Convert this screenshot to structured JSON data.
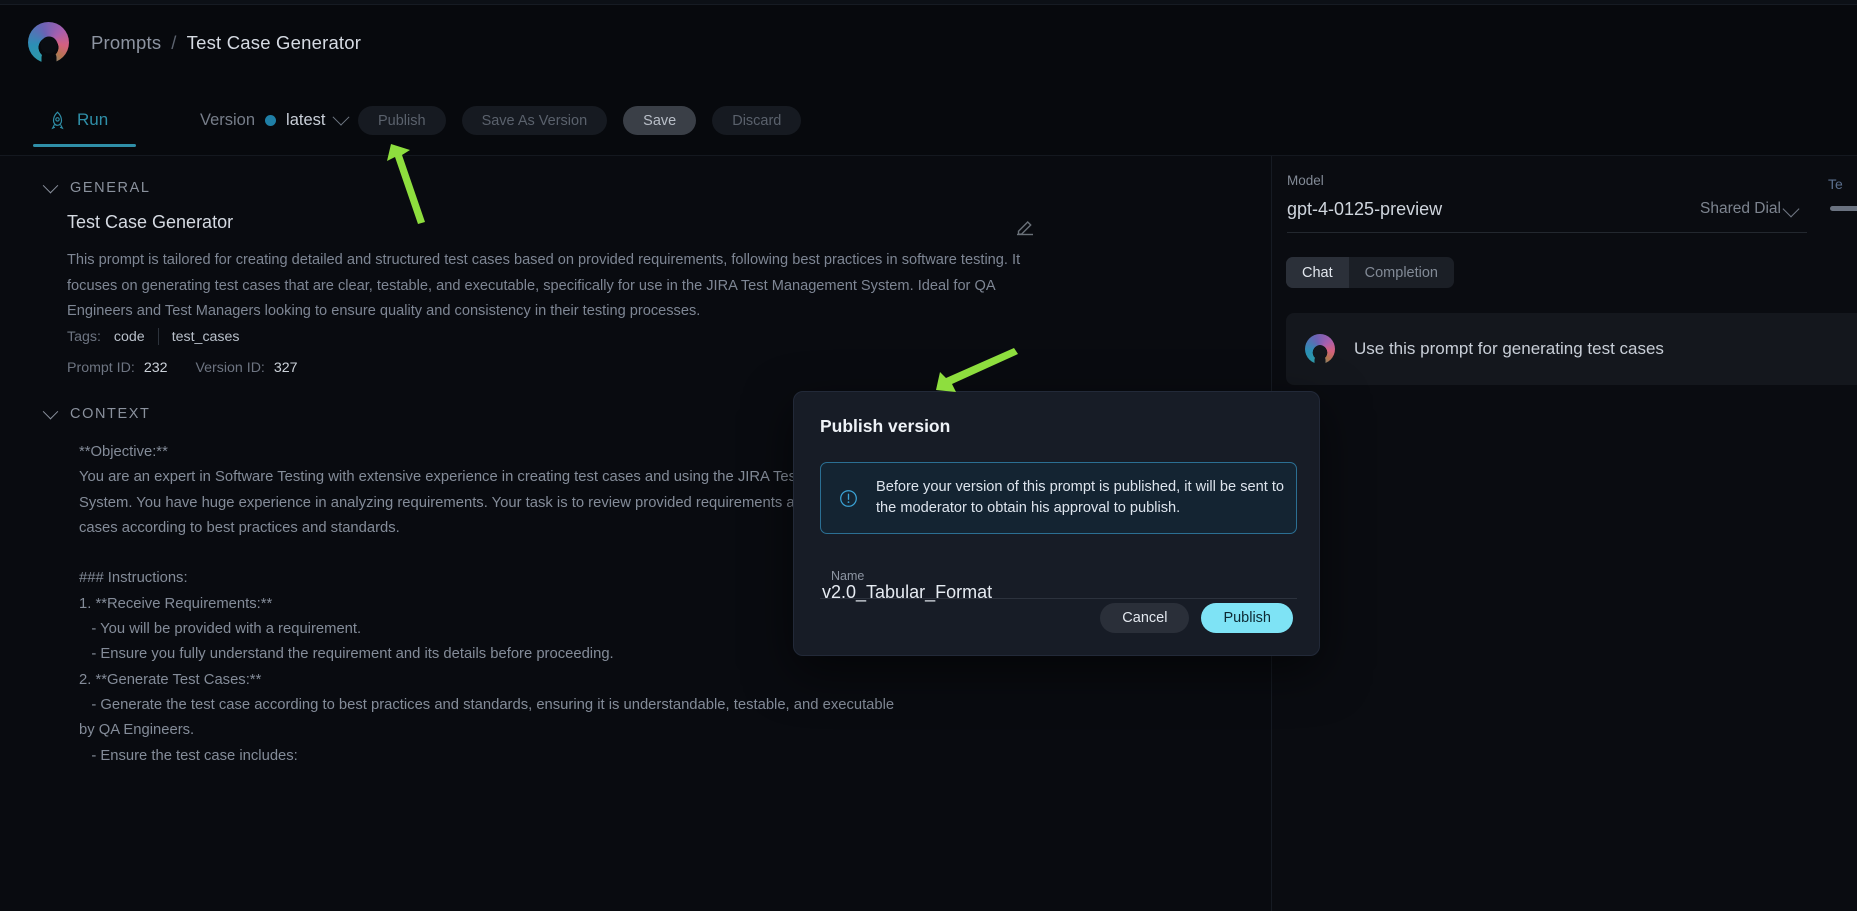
{
  "header": {
    "breadcrumb_root": "Prompts",
    "breadcrumb_separator": "/",
    "breadcrumb_current": "Test Case Generator",
    "logo_icon": "app-logo-icon"
  },
  "toolbar": {
    "tab_run_label": "Run",
    "tab_run_icon": "rocket-icon",
    "version_label": "Version",
    "version_value": "latest",
    "version_chevron_icon": "chevron-down-icon",
    "publish_label": "Publish",
    "save_as_version_label": "Save As Version",
    "save_label": "Save",
    "discard_label": "Discard"
  },
  "general": {
    "section_title": "GENERAL",
    "caret_icon": "chevron-down-icon",
    "prompt_title": "Test Case Generator",
    "edit_icon": "pencil-icon",
    "description": "This prompt is tailored for creating detailed and structured test cases based on provided requirements, following best practices in software testing. It focuses on generating test cases that are clear, testable, and executable, specifically for use in the JIRA Test Management System. Ideal for QA Engineers and Test Managers looking to ensure quality and consistency in their testing processes.",
    "tags_label": "Tags:",
    "tags": [
      "code",
      "test_cases"
    ],
    "prompt_id_label": "Prompt ID:",
    "prompt_id_value": "232",
    "version_id_label": "Version ID:",
    "version_id_value": "327"
  },
  "context": {
    "section_title": "CONTEXT",
    "caret_icon": "chevron-down-icon",
    "body": "**Objective:**\nYou are an expert in Software Testing with extensive experience in creating test cases and using the JIRA Test Management\nSystem. You have huge experience in analyzing requirements. Your task is to review provided requirements and create test\ncases according to best practices and standards.\n\n### Instructions:\n1. **Receive Requirements:**\n   - You will be provided with a requirement.\n   - Ensure you fully understand the requirement and its details before proceeding.\n2. **Generate Test Cases:**\n   - Generate the test case according to best practices and standards, ensuring it is understandable, testable, and executable\nby QA Engineers.\n   - Ensure the test case includes:"
  },
  "right_panel": {
    "model_label": "Model",
    "model_value": "gpt-4-0125-preview",
    "shared_dial_label": "Shared Dial",
    "model_chevron_icon": "chevron-down-icon",
    "temperature_label": "Te",
    "mode_tabs": [
      {
        "label": "Chat",
        "active": true
      },
      {
        "label": "Completion",
        "active": false
      }
    ],
    "chat_message": "Use this prompt for generating test cases",
    "chat_avatar_icon": "app-logo-avatar-icon"
  },
  "modal": {
    "title": "Publish version",
    "notice_icon": "info-circle-icon",
    "notice_text": "Before your version of this prompt is published, it will be sent to the moderator to obtain his approval to publish.",
    "name_label": "Name",
    "name_value": "v2.0_Tabular_Format",
    "cancel_label": "Cancel",
    "publish_label": "Publish"
  },
  "annotations": {
    "arrow_to_publish_button": "green-arrow-icon",
    "arrow_to_modal": "green-arrow-icon",
    "arrow_color": "#8ede3e"
  },
  "colors": {
    "background": "#07090d",
    "accent_teal": "#2f8fa8",
    "accent_cyan": "#7ee3f5",
    "notice_border": "#2b6f93",
    "modal_bg": "#171c26"
  }
}
